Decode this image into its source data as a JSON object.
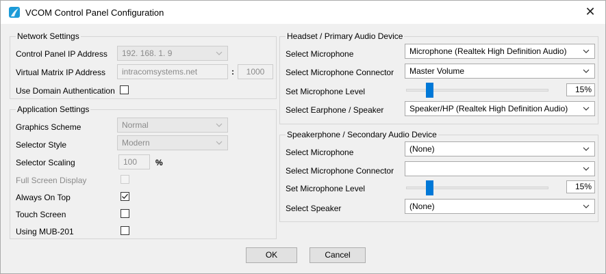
{
  "window": {
    "title": "VCOM Control Panel Configuration",
    "close_glyph": "✕"
  },
  "network": {
    "title": "Network Settings",
    "cp_ip_label": "Control Panel IP Address",
    "cp_ip_value": "192. 168. 1. 9",
    "vm_ip_label": "Virtual Matrix IP Address",
    "vm_host_value": "intracomsystems.net",
    "port_sep": ":",
    "port_value": "1000",
    "domain_auth_label": "Use Domain Authentication"
  },
  "app": {
    "title": "Application Settings",
    "graphics_label": "Graphics Scheme",
    "graphics_value": "Normal",
    "selector_style_label": "Selector Style",
    "selector_style_value": "Modern",
    "selector_scaling_label": "Selector Scaling",
    "selector_scaling_value": "100",
    "percent": "%",
    "fullscreen_label": "Full Screen Display",
    "ontop_label": "Always On Top",
    "touch_label": "Touch Screen",
    "mub_label": "Using MUB-201"
  },
  "headset": {
    "title": "Headset / Primary Audio Device",
    "mic_label": "Select Microphone",
    "mic_value": "Microphone (Realtek High Definition Audio)",
    "connector_label": "Select Microphone Connector",
    "connector_value": "Master Volume",
    "level_label": "Set Microphone Level",
    "level_value": "15%",
    "level_fraction": 0.15,
    "speaker_label": "Select Earphone / Speaker",
    "speaker_value": "Speaker/HP (Realtek High Definition Audio)"
  },
  "speakerphone": {
    "title": "Speakerphone / Secondary Audio Device",
    "mic_label": "Select Microphone",
    "mic_value": "(None)",
    "connector_label": "Select Microphone Connector",
    "connector_value": "",
    "level_label": "Set Microphone Level",
    "level_value": "15%",
    "level_fraction": 0.15,
    "speaker_label": "Select Speaker",
    "speaker_value": "(None)"
  },
  "buttons": {
    "ok": "OK",
    "cancel": "Cancel"
  },
  "colors": {
    "accent": "#0078d7",
    "app_icon": "#1b9bd8"
  }
}
